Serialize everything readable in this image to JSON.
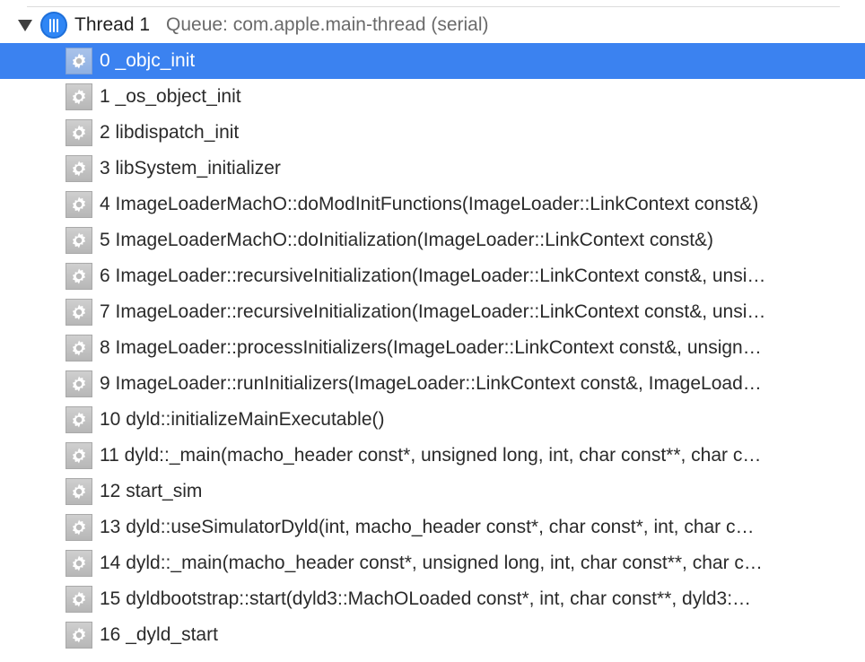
{
  "thread": {
    "title": "Thread 1",
    "queue": "Queue: com.apple.main-thread (serial)",
    "expanded": true
  },
  "colors": {
    "selection": "#3b82f0",
    "thread_icon": "#2f86f5",
    "frame_icon": "#c4c4c4"
  },
  "icons": {
    "disclosure": "disclosure-triangle-icon",
    "thread": "thread-icon",
    "frame": "gear-icon"
  },
  "selected_index": 0,
  "frames": [
    {
      "label": "0 _objc_init"
    },
    {
      "label": "1 _os_object_init"
    },
    {
      "label": "2 libdispatch_init"
    },
    {
      "label": "3 libSystem_initializer"
    },
    {
      "label": "4 ImageLoaderMachO::doModInitFunctions(ImageLoader::LinkContext const&)"
    },
    {
      "label": "5 ImageLoaderMachO::doInitialization(ImageLoader::LinkContext const&)"
    },
    {
      "label": "6 ImageLoader::recursiveInitialization(ImageLoader::LinkContext const&, unsi…"
    },
    {
      "label": "7 ImageLoader::recursiveInitialization(ImageLoader::LinkContext const&, unsi…"
    },
    {
      "label": "8 ImageLoader::processInitializers(ImageLoader::LinkContext const&, unsign…"
    },
    {
      "label": "9 ImageLoader::runInitializers(ImageLoader::LinkContext const&, ImageLoad…"
    },
    {
      "label": "10 dyld::initializeMainExecutable()"
    },
    {
      "label": "11 dyld::_main(macho_header const*, unsigned long, int, char const**, char c…"
    },
    {
      "label": "12 start_sim"
    },
    {
      "label": "13 dyld::useSimulatorDyld(int, macho_header const*, char const*, int, char c…"
    },
    {
      "label": "14 dyld::_main(macho_header const*, unsigned long, int, char const**, char c…"
    },
    {
      "label": "15 dyldbootstrap::start(dyld3::MachOLoaded const*, int, char const**, dyld3:…"
    },
    {
      "label": "16 _dyld_start"
    }
  ]
}
